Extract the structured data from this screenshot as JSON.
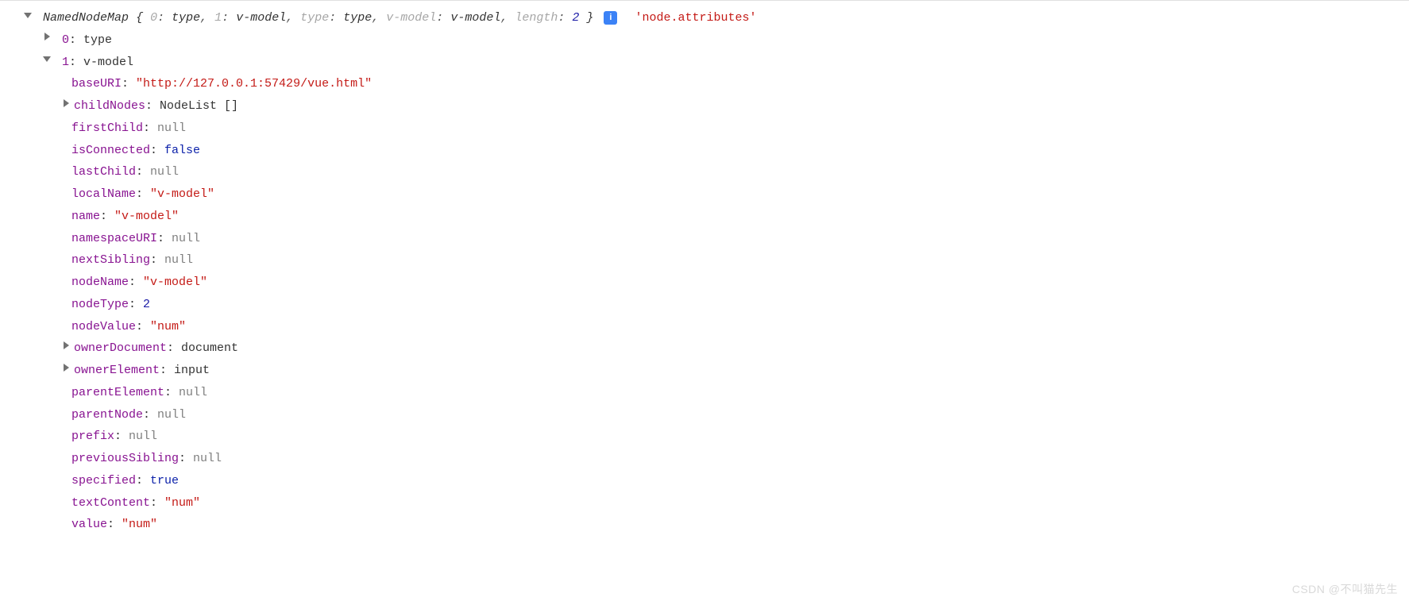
{
  "header": {
    "class_name": "NamedNodeMap",
    "preview_pairs": [
      {
        "k": "0",
        "v": "type"
      },
      {
        "k": "1",
        "v": "v-model"
      },
      {
        "k": "type",
        "v": "type"
      },
      {
        "k": "v-model",
        "v": "v-model"
      },
      {
        "k": "length",
        "v": "2",
        "num": true
      }
    ],
    "info_icon": "i",
    "source_label": "'node.attributes'"
  },
  "item0": {
    "k": "0",
    "v": "type"
  },
  "item1": {
    "k": "1",
    "v": "v-model"
  },
  "props": {
    "baseURI": {
      "k": "baseURI",
      "v": "\"http://127.0.0.1:57429/vue.html\"",
      "type": "string"
    },
    "childNodes": {
      "k": "childNodes",
      "v": "NodeList []",
      "type": "object",
      "expandable": true
    },
    "firstChild": {
      "k": "firstChild",
      "v": "null",
      "type": "null"
    },
    "isConnected": {
      "k": "isConnected",
      "v": "false",
      "type": "bool"
    },
    "lastChild": {
      "k": "lastChild",
      "v": "null",
      "type": "null"
    },
    "localName": {
      "k": "localName",
      "v": "\"v-model\"",
      "type": "string"
    },
    "name": {
      "k": "name",
      "v": "\"v-model\"",
      "type": "string"
    },
    "namespaceURI": {
      "k": "namespaceURI",
      "v": "null",
      "type": "null"
    },
    "nextSibling": {
      "k": "nextSibling",
      "v": "null",
      "type": "null"
    },
    "nodeName": {
      "k": "nodeName",
      "v": "\"v-model\"",
      "type": "string"
    },
    "nodeType": {
      "k": "nodeType",
      "v": "2",
      "type": "num"
    },
    "nodeValue": {
      "k": "nodeValue",
      "v": "\"num\"",
      "type": "string"
    },
    "ownerDocument": {
      "k": "ownerDocument",
      "v": "document",
      "type": "object",
      "expandable": true
    },
    "ownerElement": {
      "k": "ownerElement",
      "v": "input",
      "type": "object",
      "expandable": true
    },
    "parentElement": {
      "k": "parentElement",
      "v": "null",
      "type": "null"
    },
    "parentNode": {
      "k": "parentNode",
      "v": "null",
      "type": "null"
    },
    "prefix": {
      "k": "prefix",
      "v": "null",
      "type": "null"
    },
    "previousSibling": {
      "k": "previousSibling",
      "v": "null",
      "type": "null"
    },
    "specified": {
      "k": "specified",
      "v": "true",
      "type": "bool"
    },
    "textContent": {
      "k": "textContent",
      "v": "\"num\"",
      "type": "string"
    },
    "value": {
      "k": "value",
      "v": "\"num\"",
      "type": "string"
    }
  },
  "watermark": "CSDN @不叫猫先生"
}
